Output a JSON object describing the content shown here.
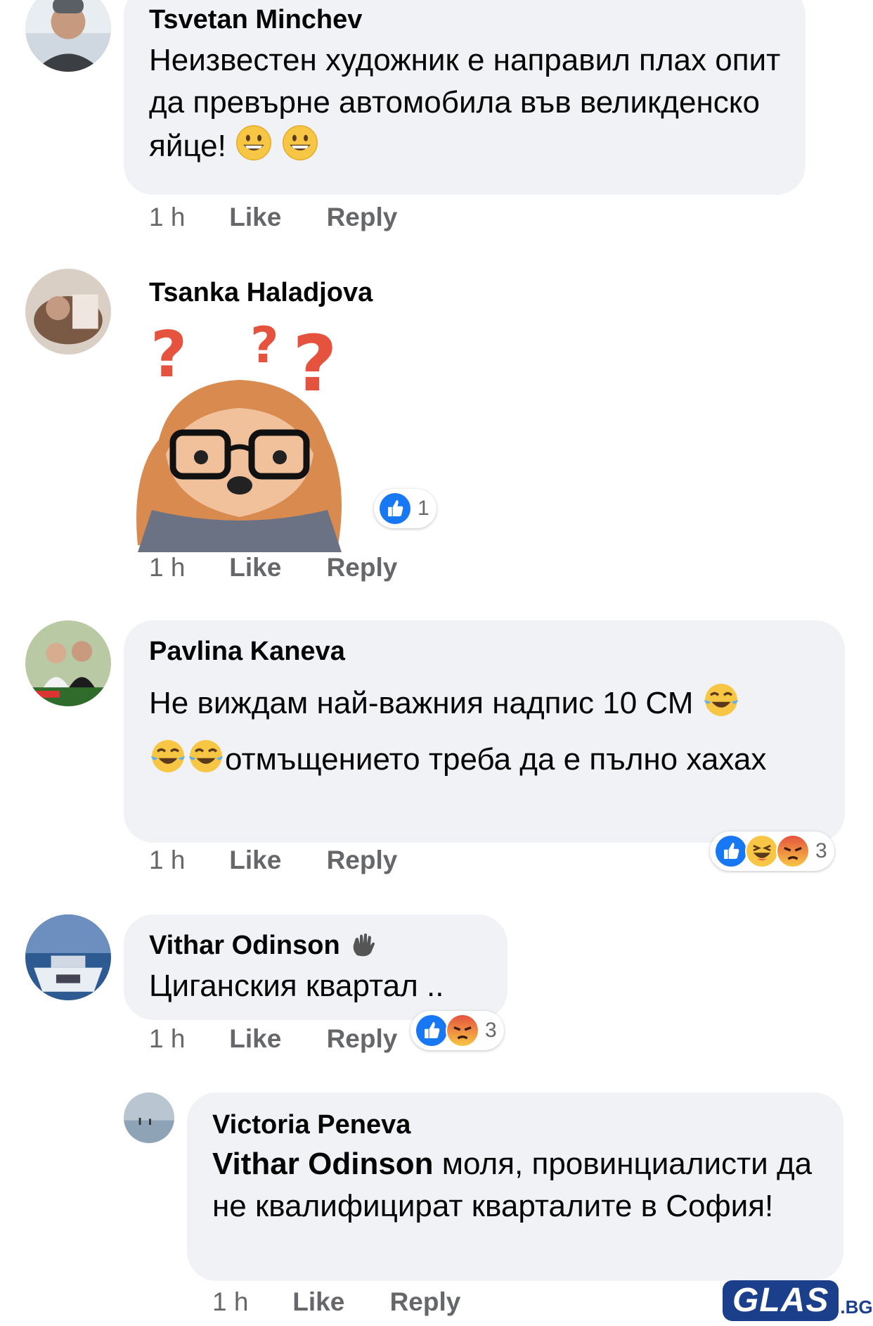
{
  "comments": [
    {
      "author": "Tsvetan Minchev",
      "text": "Неизвестен художник е направил плах опит да превърне автомобила във великденско яйце!",
      "emojis": [
        "grinning-face-emoji",
        "grinning-face-emoji"
      ],
      "time": "1 h",
      "like": "Like",
      "reply": "Reply"
    },
    {
      "author": "Tsanka Haladjova",
      "sticker": "dog-with-glasses-question-marks-sticker",
      "reaction_count": "1",
      "time": "1 h",
      "like": "Like",
      "reply": "Reply"
    },
    {
      "author": "Pavlina Kaneva",
      "text_part1": "Не виждам най-важния надпис 10 СМ",
      "text_part2": "отмъщението треба да е пълно хахах",
      "reaction_count": "3",
      "time": "1 h",
      "like": "Like",
      "reply": "Reply"
    },
    {
      "author": "Vithar Odinson",
      "text": "Циганския квартал ..",
      "reaction_count": "3",
      "time": "1 h",
      "like": "Like",
      "reply": "Reply"
    },
    {
      "author": "Victoria Peneva",
      "mention": "Vithar Odinson",
      "text": "моля, провинциалисти да не квалифицират кварталите в София!",
      "time": "1 h",
      "like": "Like",
      "reply": "Reply"
    }
  ],
  "watermark": {
    "text": "GLAS",
    "suffix": ".BG"
  },
  "colors": {
    "like_blue": "#1877f2",
    "bubble_bg": "#f0f2f5",
    "meta_gray": "#65676b",
    "angry_red": "#e9710f"
  }
}
